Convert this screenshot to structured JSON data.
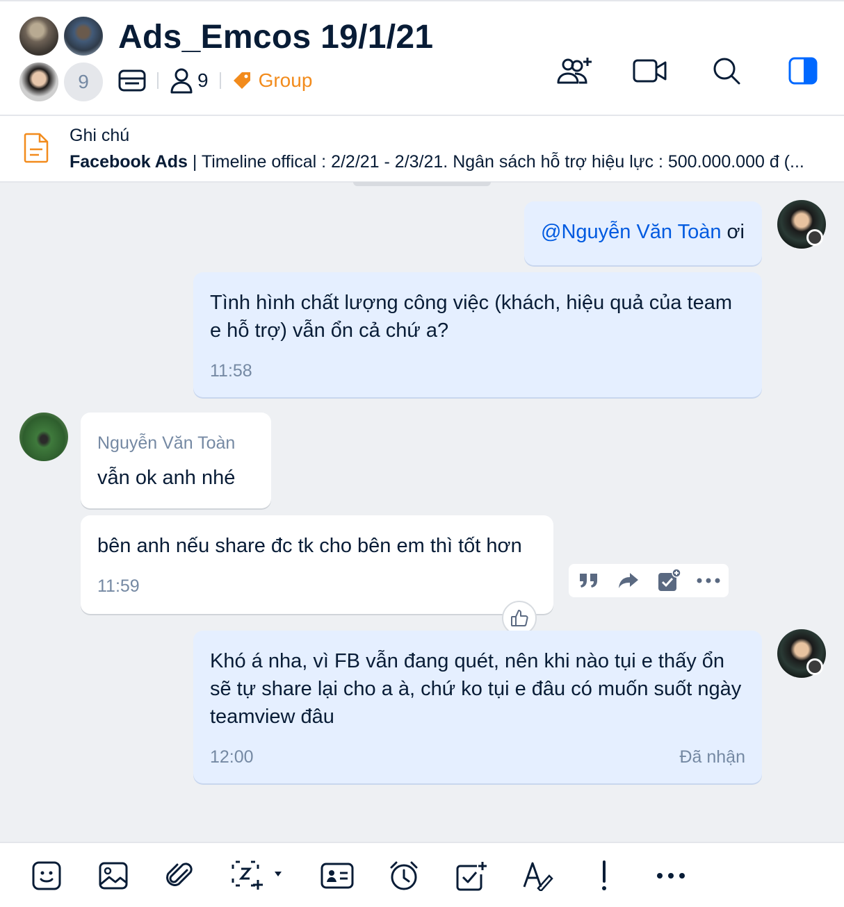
{
  "header": {
    "title": "Ads_Emcos 19/1/21",
    "avatar_overflow_count": "9",
    "member_count": "9",
    "tag_label": "Group"
  },
  "pinned_note": {
    "title": "Ghi chú",
    "bold_prefix": "Facebook Ads",
    "text": " | Timeline offical : 2/2/21 - 2/3/21. Ngân sách hỗ trợ hiệu lực : 500.000.000 đ (..."
  },
  "messages": [
    {
      "mention": "@Nguyễn Văn Toàn",
      "text": " ơi"
    },
    {
      "text": "Tình hình chất lượng công việc (khách, hiệu quả của team e hỗ trợ) vẫn ổn cả chứ a?",
      "time": "11:58"
    },
    {
      "sender": "Nguyễn Văn Toàn",
      "text": "vẫn ok anh nhé"
    },
    {
      "text": "bên anh nếu share đc tk cho bên em thì tốt hơn",
      "time": "11:59"
    },
    {
      "text": "Khó á nha, vì FB vẫn đang quét, nên khi nào tụi e thấy ổn sẽ tự share lại cho a à, chứ ko tụi e đâu có muốn suốt ngày teamview đâu",
      "time": "12:00",
      "status": "Đã nhận"
    }
  ],
  "colors": {
    "accent": "#005ae0",
    "my_bubble": "#e5efff",
    "their_bubble": "#ffffff",
    "tag": "#f28b1c",
    "background": "#eef0f3"
  },
  "icons": {
    "header_actions": [
      "add-member-icon",
      "video-call-icon",
      "search-icon",
      "sidebar-toggle-icon"
    ],
    "message_actions": [
      "quote-icon",
      "forward-icon",
      "task-icon",
      "more-icon"
    ],
    "composer": [
      "sticker-icon",
      "image-icon",
      "attach-icon",
      "screenshot-icon",
      "contact-card-icon",
      "reminder-icon",
      "todo-icon",
      "text-format-icon",
      "urgent-icon",
      "more-icon"
    ]
  }
}
